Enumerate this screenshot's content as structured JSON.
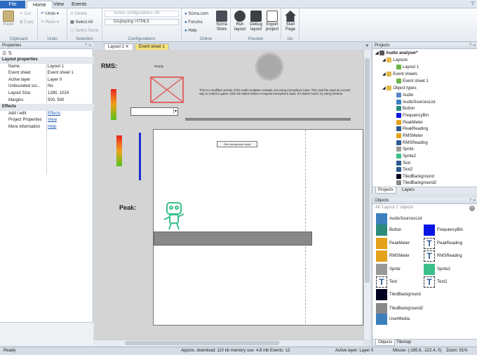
{
  "ribbon_tabs": {
    "file": "File",
    "home": "Home",
    "view": "View",
    "events": "Events"
  },
  "clipboard": {
    "paste": "Paste",
    "cut": "Cut",
    "copy": "Copy",
    "label": "Clipboard"
  },
  "undo": {
    "undo": "Undo",
    "redo": "Redo",
    "label": "Undo"
  },
  "selection": {
    "delete": "Delete",
    "select_all": "Select All",
    "select_none": "Select None",
    "label": "Selection"
  },
  "configurations": {
    "active": "Active configurations: All",
    "displaying": "Displaying: HTML5",
    "label": "Configurations"
  },
  "online": {
    "scirra": "Scirra.com",
    "forums": "Forums",
    "help": "Help",
    "store": "Scirra\nStore",
    "label": "Online"
  },
  "preview": {
    "run": "Run layout",
    "debug": "Debug layout",
    "export": "Export project",
    "label": "Preview"
  },
  "go": {
    "start": "Start Page",
    "label": "Go"
  },
  "properties": {
    "title": "Properties",
    "rows": [
      {
        "type": "sec",
        "k": "Layout properties"
      },
      {
        "k": "Name",
        "v": "Layout 1"
      },
      {
        "k": "Event sheet",
        "v": "Event sheet 1"
      },
      {
        "k": "Active layer",
        "v": "Layer 0"
      },
      {
        "k": "Unbounded scr...",
        "v": "No"
      },
      {
        "k": "Layout Size",
        "v": "1280, 1024"
      },
      {
        "k": "Margins",
        "v": "500, 500"
      },
      {
        "type": "sec",
        "k": "Effects"
      },
      {
        "k": "Add / edit",
        "v": "Effects",
        "link": true
      },
      {
        "k": "Project Properties",
        "v": "View",
        "link": true
      },
      {
        "k": "More information",
        "v": "Help",
        "link": true
      }
    ]
  },
  "doc_tabs": {
    "layout": "Layout 1",
    "events": "Event sheet 1"
  },
  "canvas": {
    "rms_label": "RMS:",
    "ready": "Ready",
    "description": "This is a modified version of the Audio Analyser example, but using microphone input. This could be used as a novel way to control a game. Click the button below to request microphone input. If it doesn't work, try using Chrome.",
    "mic_button": "Get microphone input",
    "peak_label": "Peak:"
  },
  "projects": {
    "title": "Projects",
    "root": "Audio analyser*",
    "layouts": "Layouts",
    "layout1": "Layout 1",
    "event_sheets": "Event sheets",
    "event_sheet1": "Event sheet 1",
    "object_types": "Object types",
    "types": [
      "Audio",
      "AudioSourcesList",
      "Button",
      "FrequencyBin",
      "PeakMeter",
      "PeakReading",
      "RMSMeter",
      "RMSReading",
      "Sprite",
      "Sprite2",
      "Text",
      "Text2",
      "TiledBackground",
      "TiledBackground2"
    ],
    "tabs": {
      "projects": "Projects",
      "layers": "Layers"
    }
  },
  "objects": {
    "title": "Objects",
    "filter": "All 'Layout 1' objects",
    "items": [
      "AudioSourcesList",
      "Button",
      "FrequencyBin",
      "PeakMeter",
      "PeakReading",
      "RMSMeter",
      "RMSReading",
      "Sprite",
      "Sprite2",
      "Text",
      "Text2",
      "TiledBackground",
      "TiledBackground2",
      "UserMedia"
    ],
    "tabs": {
      "objects": "Objects",
      "tilemap": "Tilemap"
    }
  },
  "status": {
    "ready": "Ready",
    "download": "Approx. download: 110 kb  memory use: 4.8 mb  Events: 12",
    "layer": "Active layer: Layer 0",
    "mouse": "Mouse: (-165.6, -222.4, 0)",
    "zoom": "Zoom: 51%"
  },
  "colors": {
    "accent": "#2d6bc1",
    "event_tab": "#f5e27a",
    "frequency_bin": "#0a16e6",
    "meter_blue": "#1c2fd6"
  }
}
